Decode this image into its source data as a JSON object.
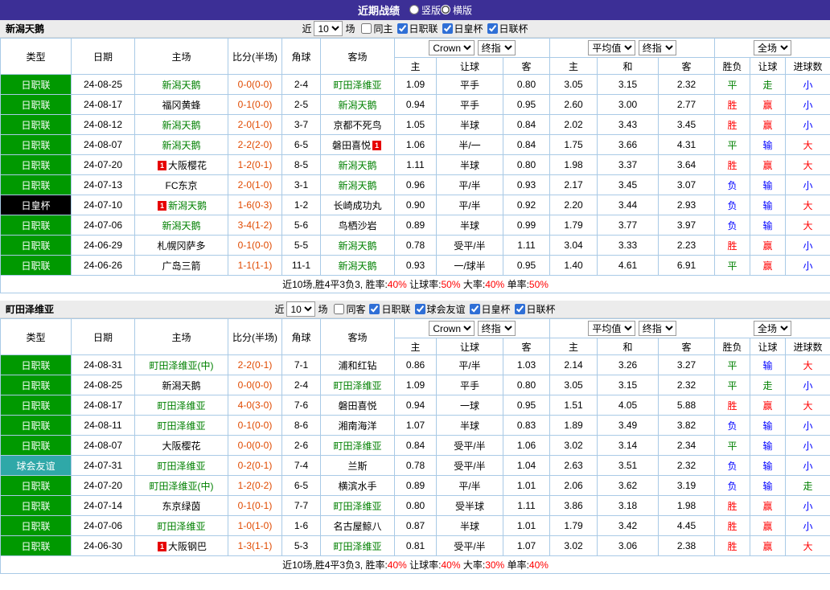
{
  "topbar": {
    "title": "近期战绩",
    "layout_options": [
      {
        "label": "竖版",
        "selected": false
      },
      {
        "label": "横版",
        "selected": true
      }
    ]
  },
  "table_header": {
    "type": "类型",
    "date": "日期",
    "home": "主场",
    "score": "比分(半场)",
    "corner": "角球",
    "away": "客场",
    "asian_selects": [
      "Crown",
      "终指"
    ],
    "asian_cols": [
      "主",
      "让球",
      "客"
    ],
    "avg_selects": [
      "平均值",
      "终指"
    ],
    "avg_cols": [
      "主",
      "和",
      "客"
    ],
    "scope_selects": [
      "全场"
    ],
    "result_cols": [
      "胜负",
      "让球",
      "进球数"
    ]
  },
  "colors": {
    "topbar_bg": "#3c2f96",
    "team_green": "#008000",
    "score": "#e04a00",
    "summary_value": "#ff0000",
    "league": {
      "日职联": "#009900",
      "日皇杯": "#000000",
      "球会友谊": "#2fa8a8",
      "日联杯": "#009900"
    },
    "result": {
      "胜": "#ff0000",
      "平": "#008000",
      "负": "#0000ff",
      "赢": "#ff0000",
      "走": "#008000",
      "输": "#0000ff",
      "大": "#ff0000",
      "小": "#0000ff"
    }
  },
  "sections": [
    {
      "team": "新潟天鹅",
      "filter": {
        "near": "近",
        "count": "10",
        "games": "场",
        "checkboxes": [
          {
            "label": "同主",
            "checked": false
          },
          {
            "label": "日职联",
            "checked": true
          },
          {
            "label": "日皇杯",
            "checked": true
          },
          {
            "label": "日联杯",
            "checked": true
          }
        ]
      },
      "rows": [
        {
          "league": "日职联",
          "date": "24-08-25",
          "home": "新潟天鹅",
          "home_green": true,
          "score": "0-0(0-0)",
          "corner": "2-4",
          "away": "町田泽维亚",
          "away_green": true,
          "ah_home": "1.09",
          "ah_line": "平手",
          "ah_away": "0.80",
          "avg_home": "3.05",
          "avg_draw": "3.15",
          "avg_away": "2.32",
          "res_wdl": "平",
          "res_ah": "走",
          "res_goal": "小"
        },
        {
          "league": "日职联",
          "date": "24-08-17",
          "home": "福冈黄蜂",
          "home_green": false,
          "score": "0-1(0-0)",
          "corner": "2-5",
          "away": "新潟天鹅",
          "away_green": true,
          "ah_home": "0.94",
          "ah_line": "平手",
          "ah_away": "0.95",
          "avg_home": "2.60",
          "avg_draw": "3.00",
          "avg_away": "2.77",
          "res_wdl": "胜",
          "res_ah": "赢",
          "res_goal": "小"
        },
        {
          "league": "日职联",
          "date": "24-08-12",
          "home": "新潟天鹅",
          "home_green": true,
          "score": "2-0(1-0)",
          "corner": "3-7",
          "away": "京都不死鸟",
          "away_green": false,
          "ah_home": "1.05",
          "ah_line": "半球",
          "ah_away": "0.84",
          "avg_home": "2.02",
          "avg_draw": "3.43",
          "avg_away": "3.45",
          "res_wdl": "胜",
          "res_ah": "赢",
          "res_goal": "小"
        },
        {
          "league": "日职联",
          "date": "24-08-07",
          "home": "新潟天鹅",
          "home_green": true,
          "score": "2-2(2-0)",
          "corner": "6-5",
          "away": "磐田喜悦",
          "away_green": false,
          "away_badge": "1",
          "away_badge_pos": "after",
          "ah_home": "1.06",
          "ah_line": "半/一",
          "ah_away": "0.84",
          "avg_home": "1.75",
          "avg_draw": "3.66",
          "avg_away": "4.31",
          "res_wdl": "平",
          "res_ah": "输",
          "res_goal": "大"
        },
        {
          "league": "日职联",
          "date": "24-07-20",
          "home": "大阪樱花",
          "home_green": false,
          "home_badge": "1",
          "home_badge_pos": "before",
          "score": "1-2(0-1)",
          "corner": "8-5",
          "away": "新潟天鹅",
          "away_green": true,
          "ah_home": "1.11",
          "ah_line": "半球",
          "ah_away": "0.80",
          "avg_home": "1.98",
          "avg_draw": "3.37",
          "avg_away": "3.64",
          "res_wdl": "胜",
          "res_ah": "赢",
          "res_goal": "大"
        },
        {
          "league": "日职联",
          "date": "24-07-13",
          "home": "FC东京",
          "home_green": false,
          "score": "2-0(1-0)",
          "corner": "3-1",
          "away": "新潟天鹅",
          "away_green": true,
          "ah_home": "0.96",
          "ah_line": "平/半",
          "ah_away": "0.93",
          "avg_home": "2.17",
          "avg_draw": "3.45",
          "avg_away": "3.07",
          "res_wdl": "负",
          "res_ah": "输",
          "res_goal": "小"
        },
        {
          "league": "日皇杯",
          "date": "24-07-10",
          "home": "新潟天鹅",
          "home_green": true,
          "home_badge": "1",
          "home_badge_pos": "before",
          "score": "1-6(0-3)",
          "corner": "1-2",
          "away": "长崎成功丸",
          "away_green": false,
          "ah_home": "0.90",
          "ah_line": "平/半",
          "ah_away": "0.92",
          "avg_home": "2.20",
          "avg_draw": "3.44",
          "avg_away": "2.93",
          "res_wdl": "负",
          "res_ah": "输",
          "res_goal": "大"
        },
        {
          "league": "日职联",
          "date": "24-07-06",
          "home": "新潟天鹅",
          "home_green": true,
          "score": "3-4(1-2)",
          "corner": "5-6",
          "away": "鸟栖沙岩",
          "away_green": false,
          "ah_home": "0.89",
          "ah_line": "半球",
          "ah_away": "0.99",
          "avg_home": "1.79",
          "avg_draw": "3.77",
          "avg_away": "3.97",
          "res_wdl": "负",
          "res_ah": "输",
          "res_goal": "大"
        },
        {
          "league": "日职联",
          "date": "24-06-29",
          "home": "札幌冈萨多",
          "home_green": false,
          "score": "0-1(0-0)",
          "corner": "5-5",
          "away": "新潟天鹅",
          "away_green": true,
          "ah_home": "0.78",
          "ah_line": "受平/半",
          "ah_away": "1.11",
          "avg_home": "3.04",
          "avg_draw": "3.33",
          "avg_away": "2.23",
          "res_wdl": "胜",
          "res_ah": "赢",
          "res_goal": "小"
        },
        {
          "league": "日职联",
          "date": "24-06-26",
          "home": "广岛三箭",
          "home_green": false,
          "score": "1-1(1-1)",
          "corner": "11-1",
          "away": "新潟天鹅",
          "away_green": true,
          "ah_home": "0.93",
          "ah_line": "一/球半",
          "ah_away": "0.95",
          "avg_home": "1.40",
          "avg_draw": "4.61",
          "avg_away": "6.91",
          "res_wdl": "平",
          "res_ah": "赢",
          "res_goal": "小"
        }
      ],
      "footer": {
        "prefix": "近10场,胜4平3负3, ",
        "stats": [
          {
            "label": "胜率:",
            "value": "40%"
          },
          {
            "label": " 让球率:",
            "value": "50%"
          },
          {
            "label": " 大率:",
            "value": "40%"
          },
          {
            "label": " 单率:",
            "value": "50%"
          }
        ]
      }
    },
    {
      "team": "町田泽维亚",
      "filter": {
        "near": "近",
        "count": "10",
        "games": "场",
        "checkboxes": [
          {
            "label": "同客",
            "checked": false
          },
          {
            "label": "日职联",
            "checked": true
          },
          {
            "label": "球会友谊",
            "checked": true
          },
          {
            "label": "日皇杯",
            "checked": true
          },
          {
            "label": "日联杯",
            "checked": true
          }
        ]
      },
      "rows": [
        {
          "league": "日职联",
          "date": "24-08-31",
          "home": "町田泽维亚(中)",
          "home_green": true,
          "score": "2-2(0-1)",
          "corner": "7-1",
          "away": "浦和红钻",
          "away_green": false,
          "ah_home": "0.86",
          "ah_line": "平/半",
          "ah_away": "1.03",
          "avg_home": "2.14",
          "avg_draw": "3.26",
          "avg_away": "3.27",
          "res_wdl": "平",
          "res_ah": "输",
          "res_goal": "大"
        },
        {
          "league": "日职联",
          "date": "24-08-25",
          "home": "新潟天鹅",
          "home_green": false,
          "score": "0-0(0-0)",
          "corner": "2-4",
          "away": "町田泽维亚",
          "away_green": true,
          "ah_home": "1.09",
          "ah_line": "平手",
          "ah_away": "0.80",
          "avg_home": "3.05",
          "avg_draw": "3.15",
          "avg_away": "2.32",
          "res_wdl": "平",
          "res_ah": "走",
          "res_goal": "小"
        },
        {
          "league": "日职联",
          "date": "24-08-17",
          "home": "町田泽维亚",
          "home_green": true,
          "score": "4-0(3-0)",
          "corner": "7-6",
          "away": "磐田喜悦",
          "away_green": false,
          "ah_home": "0.94",
          "ah_line": "一球",
          "ah_away": "0.95",
          "avg_home": "1.51",
          "avg_draw": "4.05",
          "avg_away": "5.88",
          "res_wdl": "胜",
          "res_ah": "赢",
          "res_goal": "大"
        },
        {
          "league": "日职联",
          "date": "24-08-11",
          "home": "町田泽维亚",
          "home_green": true,
          "score": "0-1(0-0)",
          "corner": "8-6",
          "away": "湘南海洋",
          "away_green": false,
          "ah_home": "1.07",
          "ah_line": "半球",
          "ah_away": "0.83",
          "avg_home": "1.89",
          "avg_draw": "3.49",
          "avg_away": "3.82",
          "res_wdl": "负",
          "res_ah": "输",
          "res_goal": "小"
        },
        {
          "league": "日职联",
          "date": "24-08-07",
          "home": "大阪樱花",
          "home_green": false,
          "score": "0-0(0-0)",
          "corner": "2-6",
          "away": "町田泽维亚",
          "away_green": true,
          "ah_home": "0.84",
          "ah_line": "受平/半",
          "ah_away": "1.06",
          "avg_home": "3.02",
          "avg_draw": "3.14",
          "avg_away": "2.34",
          "res_wdl": "平",
          "res_ah": "输",
          "res_goal": "小"
        },
        {
          "league": "球会友谊",
          "date": "24-07-31",
          "home": "町田泽维亚",
          "home_green": true,
          "score": "0-2(0-1)",
          "corner": "7-4",
          "away": "兰斯",
          "away_green": false,
          "ah_home": "0.78",
          "ah_line": "受平/半",
          "ah_away": "1.04",
          "avg_home": "2.63",
          "avg_draw": "3.51",
          "avg_away": "2.32",
          "res_wdl": "负",
          "res_ah": "输",
          "res_goal": "小"
        },
        {
          "league": "日职联",
          "date": "24-07-20",
          "home": "町田泽维亚(中)",
          "home_green": true,
          "score": "1-2(0-2)",
          "corner": "6-5",
          "away": "横滨水手",
          "away_green": false,
          "ah_home": "0.89",
          "ah_line": "平/半",
          "ah_away": "1.01",
          "avg_home": "2.06",
          "avg_draw": "3.62",
          "avg_away": "3.19",
          "res_wdl": "负",
          "res_ah": "输",
          "res_goal": "走"
        },
        {
          "league": "日职联",
          "date": "24-07-14",
          "home": "东京绿茵",
          "home_green": false,
          "score": "0-1(0-1)",
          "corner": "7-7",
          "away": "町田泽维亚",
          "away_green": true,
          "ah_home": "0.80",
          "ah_line": "受半球",
          "ah_away": "1.11",
          "avg_home": "3.86",
          "avg_draw": "3.18",
          "avg_away": "1.98",
          "res_wdl": "胜",
          "res_ah": "赢",
          "res_goal": "小"
        },
        {
          "league": "日职联",
          "date": "24-07-06",
          "home": "町田泽维亚",
          "home_green": true,
          "score": "1-0(1-0)",
          "corner": "1-6",
          "away": "名古屋鲸八",
          "away_green": false,
          "ah_home": "0.87",
          "ah_line": "半球",
          "ah_away": "1.01",
          "avg_home": "1.79",
          "avg_draw": "3.42",
          "avg_away": "4.45",
          "res_wdl": "胜",
          "res_ah": "赢",
          "res_goal": "小"
        },
        {
          "league": "日职联",
          "date": "24-06-30",
          "home": "大阪钢巴",
          "home_green": false,
          "home_badge": "1",
          "home_badge_pos": "before",
          "score": "1-3(1-1)",
          "corner": "5-3",
          "away": "町田泽维亚",
          "away_green": true,
          "ah_home": "0.81",
          "ah_line": "受平/半",
          "ah_away": "1.07",
          "avg_home": "3.02",
          "avg_draw": "3.06",
          "avg_away": "2.38",
          "res_wdl": "胜",
          "res_ah": "赢",
          "res_goal": "大"
        }
      ],
      "footer": {
        "prefix": "近10场,胜4平3负3, ",
        "stats": [
          {
            "label": "胜率:",
            "value": "40%"
          },
          {
            "label": " 让球率:",
            "value": "40%"
          },
          {
            "label": " 大率:",
            "value": "30%"
          },
          {
            "label": " 单率:",
            "value": "40%"
          }
        ]
      }
    }
  ]
}
